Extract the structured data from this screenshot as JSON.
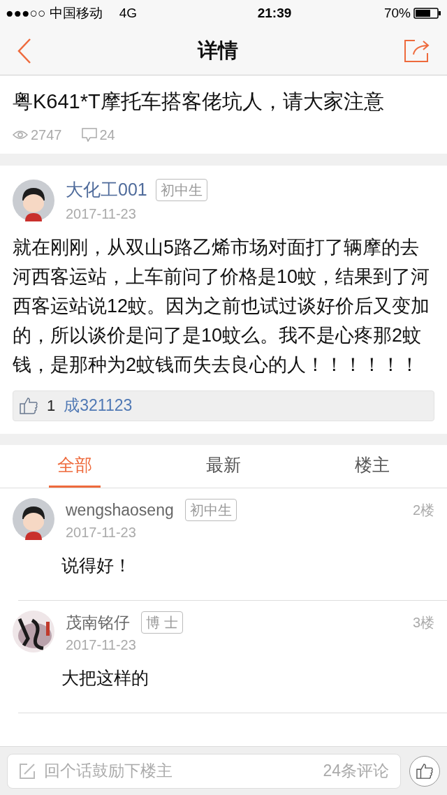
{
  "status_bar": {
    "carrier": "●●●○○ 中国移动",
    "network": "4G",
    "time": "21:39",
    "battery": "70%"
  },
  "nav": {
    "title": "详情"
  },
  "post": {
    "title": "粤K641*T摩托车搭客佬坑人，请大家注意",
    "views": "2747",
    "comments": "24",
    "author": {
      "name": "大化工001",
      "badge": "初中生",
      "date": "2017-11-23"
    },
    "body": "就在刚刚，从双山5路乙烯市场对面打了辆摩的去河西客运站，上车前问了价格是10蚊，结果到了河西客运站说12蚊。因为之前也试过谈好价后又变加的，所以谈价是问了是10蚊么。我不是心疼那2蚊钱，是那种为2蚊钱而失去良心的人！！！！！！",
    "likes": {
      "count": "1",
      "users": "成321123"
    }
  },
  "tabs": [
    {
      "label": "全部",
      "selected": true
    },
    {
      "label": "最新",
      "selected": false
    },
    {
      "label": "楼主",
      "selected": false
    }
  ],
  "comments": [
    {
      "kind": "cartoon",
      "name": "wengshaoseng",
      "badge": "初中生",
      "date": "2017-11-23",
      "floor": "2楼",
      "text": "说得好！"
    },
    {
      "kind": "picture",
      "name": "茂南铭仔",
      "badge": "博 士",
      "date": "2017-11-23",
      "floor": "3楼",
      "text": "大把这样的"
    }
  ],
  "reply_bar": {
    "placeholder": "回个话鼓励下楼主",
    "count": "24条评论"
  }
}
